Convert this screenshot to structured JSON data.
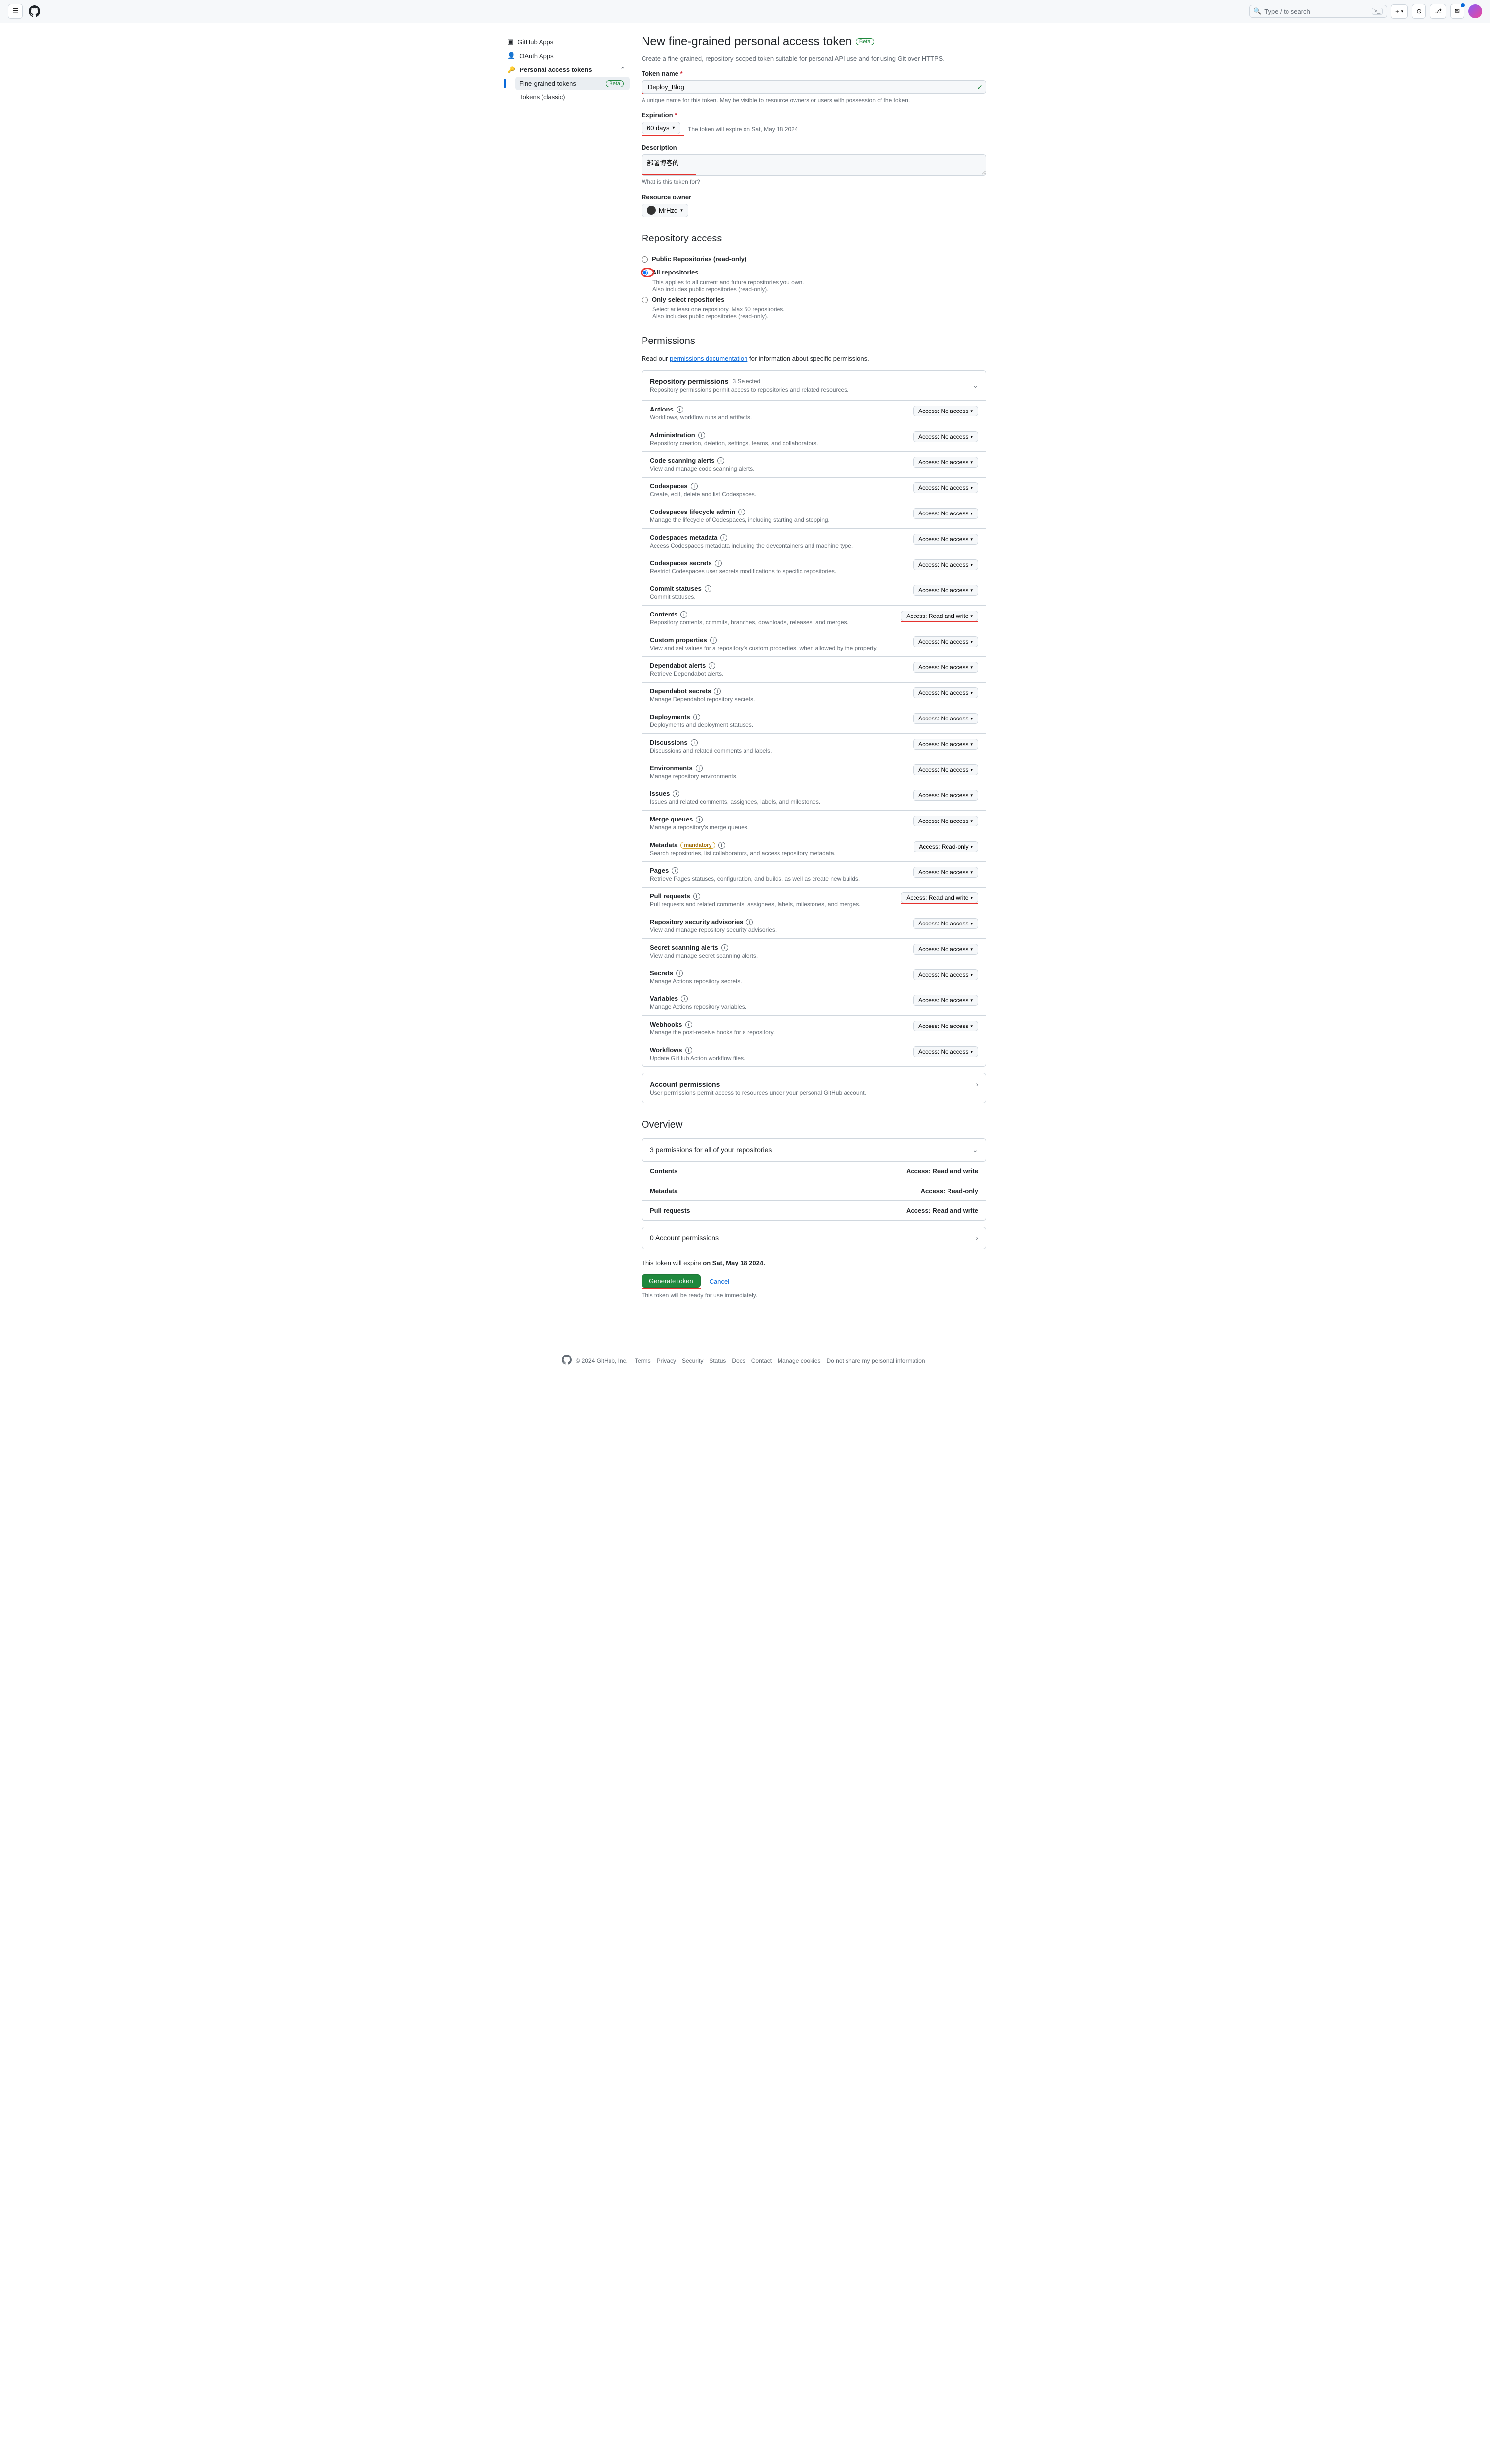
{
  "header": {
    "search_placeholder": "Type / to search",
    "search_shortcut": ">_"
  },
  "sidebar": {
    "items": [
      "GitHub Apps",
      "OAuth Apps",
      "Personal access tokens"
    ],
    "sub": [
      "Fine-grained tokens",
      "Tokens (classic)"
    ],
    "beta": "Beta"
  },
  "page": {
    "title": "New fine-grained personal access token",
    "beta": "Beta",
    "subtitle": "Create a fine-grained, repository-scoped token suitable for personal API use and for using Git over HTTPS.",
    "token_name_label": "Token name",
    "token_name_value": "Deploy_Blog",
    "token_name_help": "A unique name for this token. May be visible to resource owners or users with possession of the token.",
    "expiration_label": "Expiration",
    "expiration_value": "60 days",
    "expiration_note": "The token will expire on Sat, May 18 2024",
    "description_label": "Description",
    "description_value": "部署博客的",
    "description_help": "What is this token for?",
    "owner_label": "Resource owner",
    "owner_name": "MrHzq",
    "repo_access_title": "Repository access",
    "repo_opts": [
      {
        "label": "Public Repositories (read-only)"
      },
      {
        "label": "All repositories",
        "sub1": "This applies to all current and future repositories you own.",
        "sub2": "Also includes public repositories (read-only)."
      },
      {
        "label": "Only select repositories",
        "sub1": "Select at least one repository. Max 50 repositories.",
        "sub2": "Also includes public repositories (read-only)."
      }
    ],
    "permissions_title": "Permissions",
    "perm_note_pre": "Read our ",
    "perm_note_link": "permissions documentation",
    "perm_note_post": " for information about specific permissions.",
    "repo_perm_title": "Repository permissions",
    "repo_perm_count": "3 Selected",
    "repo_perm_desc": "Repository permissions permit access to repositories and related resources.",
    "account_perm_title": "Account permissions",
    "account_perm_desc": "User permissions permit access to resources under your personal GitHub account.",
    "overview_title": "Overview",
    "overview_header": "3 permissions for all of your repositories",
    "overview_items": [
      {
        "name": "Contents",
        "access": "Access: Read and write"
      },
      {
        "name": "Metadata",
        "access": "Access: Read-only"
      },
      {
        "name": "Pull requests",
        "access": "Access: Read and write"
      }
    ],
    "account_count": "0 Account permissions",
    "expire_note_pre": "This token will expire ",
    "expire_note_bold": "on Sat, May 18 2024.",
    "generate_btn": "Generate token",
    "cancel_btn": "Cancel",
    "ready_note": "This token will be ready for use immediately."
  },
  "perms": [
    {
      "name": "Actions",
      "desc": "Workflows, workflow runs and artifacts.",
      "access": "Access: No access"
    },
    {
      "name": "Administration",
      "desc": "Repository creation, deletion, settings, teams, and collaborators.",
      "access": "Access: No access"
    },
    {
      "name": "Code scanning alerts",
      "desc": "View and manage code scanning alerts.",
      "access": "Access: No access"
    },
    {
      "name": "Codespaces",
      "desc": "Create, edit, delete and list Codespaces.",
      "access": "Access: No access"
    },
    {
      "name": "Codespaces lifecycle admin",
      "desc": "Manage the lifecycle of Codespaces, including starting and stopping.",
      "access": "Access: No access"
    },
    {
      "name": "Codespaces metadata",
      "desc": "Access Codespaces metadata including the devcontainers and machine type.",
      "access": "Access: No access"
    },
    {
      "name": "Codespaces secrets",
      "desc": "Restrict Codespaces user secrets modifications to specific repositories.",
      "access": "Access: No access"
    },
    {
      "name": "Commit statuses",
      "desc": "Commit statuses.",
      "access": "Access: No access"
    },
    {
      "name": "Contents",
      "desc": "Repository contents, commits, branches, downloads, releases, and merges.",
      "access": "Access: Read and write",
      "highlight": true
    },
    {
      "name": "Custom properties",
      "desc": "View and set values for a repository's custom properties, when allowed by the property.",
      "access": "Access: No access"
    },
    {
      "name": "Dependabot alerts",
      "desc": "Retrieve Dependabot alerts.",
      "access": "Access: No access"
    },
    {
      "name": "Dependabot secrets",
      "desc": "Manage Dependabot repository secrets.",
      "access": "Access: No access"
    },
    {
      "name": "Deployments",
      "desc": "Deployments and deployment statuses.",
      "access": "Access: No access"
    },
    {
      "name": "Discussions",
      "desc": "Discussions and related comments and labels.",
      "access": "Access: No access"
    },
    {
      "name": "Environments",
      "desc": "Manage repository environments.",
      "access": "Access: No access"
    },
    {
      "name": "Issues",
      "desc": "Issues and related comments, assignees, labels, and milestones.",
      "access": "Access: No access"
    },
    {
      "name": "Merge queues",
      "desc": "Manage a repository's merge queues.",
      "access": "Access: No access"
    },
    {
      "name": "Metadata",
      "desc": "Search repositories, list collaborators, and access repository metadata.",
      "access": "Access: Read-only",
      "mandatory": true
    },
    {
      "name": "Pages",
      "desc": "Retrieve Pages statuses, configuration, and builds, as well as create new builds.",
      "access": "Access: No access"
    },
    {
      "name": "Pull requests",
      "desc": "Pull requests and related comments, assignees, labels, milestones, and merges.",
      "access": "Access: Read and write",
      "highlight": true
    },
    {
      "name": "Repository security advisories",
      "desc": "View and manage repository security advisories.",
      "access": "Access: No access"
    },
    {
      "name": "Secret scanning alerts",
      "desc": "View and manage secret scanning alerts.",
      "access": "Access: No access"
    },
    {
      "name": "Secrets",
      "desc": "Manage Actions repository secrets.",
      "access": "Access: No access"
    },
    {
      "name": "Variables",
      "desc": "Manage Actions repository variables.",
      "access": "Access: No access"
    },
    {
      "name": "Webhooks",
      "desc": "Manage the post-receive hooks for a repository.",
      "access": "Access: No access"
    },
    {
      "name": "Workflows",
      "desc": "Update GitHub Action workflow files.",
      "access": "Access: No access"
    }
  ],
  "footer": {
    "copyright": "© 2024 GitHub, Inc.",
    "links": [
      "Terms",
      "Privacy",
      "Security",
      "Status",
      "Docs",
      "Contact",
      "Manage cookies",
      "Do not share my personal information"
    ]
  }
}
